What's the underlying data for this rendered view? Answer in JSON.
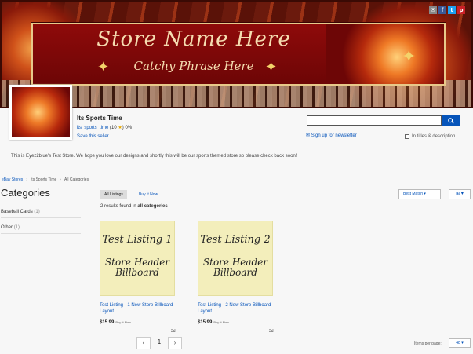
{
  "banner": {
    "store_name": "Store Name Here",
    "catchy_phrase": "Catchy Phrase Here",
    "social_icons": [
      "email-icon",
      "facebook-icon",
      "twitter-icon",
      "pinterest-icon"
    ]
  },
  "store": {
    "title": "Its Sports Time",
    "username": "its_sports_time",
    "feedback_count": "(10",
    "feedback_close": ")",
    "feedback_percent": "0%",
    "save_seller": "Save this seller",
    "description": "This is Eyez2blue's Test Store. We hope you love our designs and shortly this will be our sports themed store so please check back soon!"
  },
  "search": {
    "placeholder": "",
    "newsletter": "Sign up for newsletter",
    "titles_desc": "In titles & description"
  },
  "breadcrumb": [
    "eBay Stores",
    "Its Sports Time",
    "All Categories"
  ],
  "sidebar": {
    "heading": "Categories",
    "items": [
      {
        "label": "Baseball Cards",
        "count": "(1)"
      },
      {
        "label": "Other",
        "count": "(1)"
      }
    ]
  },
  "tabs": {
    "all": "All Listings",
    "bin": "Buy It Now"
  },
  "sort": {
    "label": "Best Match ▾"
  },
  "view": {
    "label": "⊞ ▾"
  },
  "results": {
    "prefix": "2 results found in ",
    "bold": "all categories"
  },
  "listings": [
    {
      "img_line1": "Test Listing 1",
      "img_line2": "Store Header Billboard",
      "title": "Test Listing - 1 New Store Billboard Layout",
      "price": "$15.99",
      "buy_now": "Buy It Now",
      "time_left": "3d"
    },
    {
      "img_line1": "Test Listing 2",
      "img_line2": "Store Header Billboard",
      "title": "Test Listing - 2 New Store Billboard Layout",
      "price": "$15.99",
      "buy_now": "Buy It Now",
      "time_left": "3d"
    }
  ],
  "pagination": {
    "prev": "‹",
    "current": "1",
    "next": "›",
    "per_page_label": "Items per page:",
    "per_page_value": "48 ▾"
  },
  "colors": {
    "link": "#0654ba",
    "banner_red": "#8e0a0a",
    "listing_bg": "#f3eebb"
  }
}
